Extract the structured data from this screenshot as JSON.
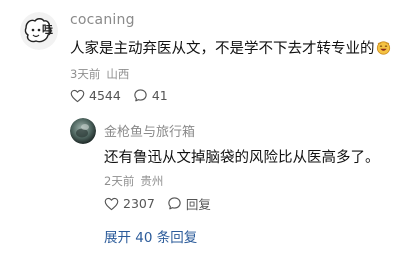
{
  "main_comment": {
    "username": "cocaning",
    "text": "人家是主动弃医从文，不是学不下去才转专业的",
    "time": "3天前",
    "location": "山西",
    "likes": "4544",
    "comments": "41"
  },
  "reply": {
    "username": "金枪鱼与旅行箱",
    "text": "还有鲁迅从文掉脑袋的风险比从医高多了。",
    "time": "2天前",
    "location": "贵州",
    "likes": "2307",
    "reply_label": "回复"
  },
  "expand_label": "展开 40 条回复",
  "icons": {
    "like": "heart-icon",
    "comment": "comment-icon",
    "emoji": "laughing-emoji-icon"
  },
  "colors": {
    "link": "#2b5b9a",
    "meta": "#8f8f8f"
  }
}
